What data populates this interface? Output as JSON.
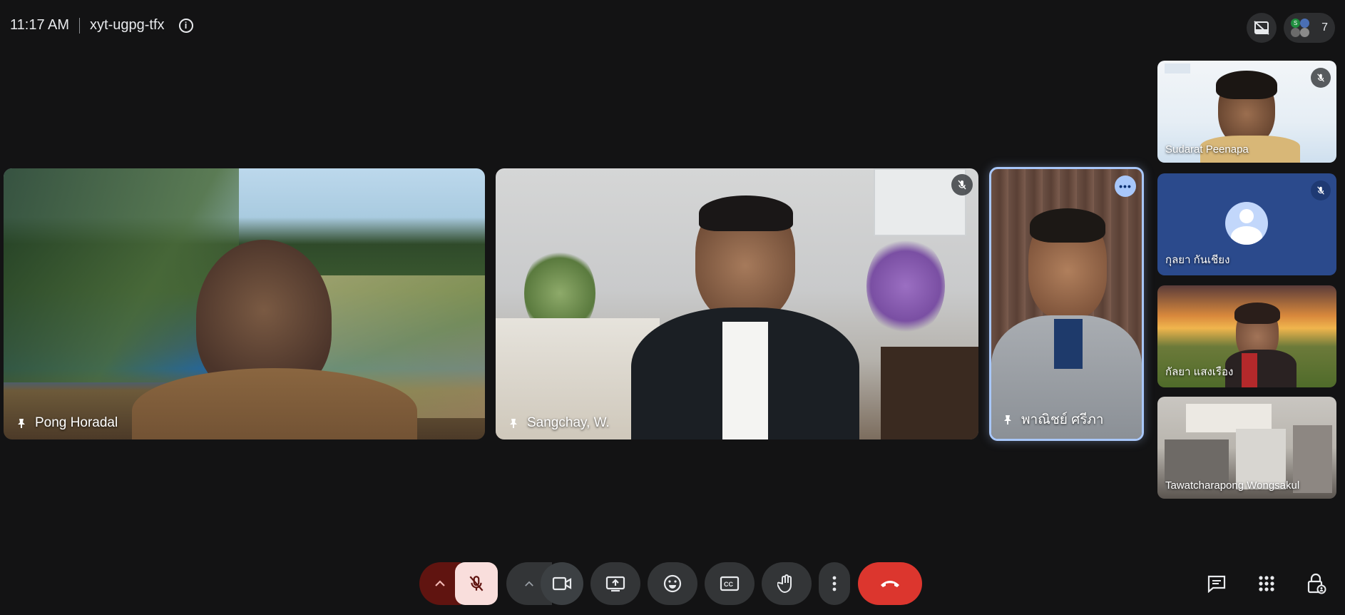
{
  "meeting": {
    "time": "11:17 AM",
    "code": "xyt-ugpg-tfx"
  },
  "participants_count": "7",
  "main_tiles": [
    {
      "name": "Pong Horadal"
    },
    {
      "name": "Sangchay, W."
    },
    {
      "name": "พาณิชย์ ศรีภา"
    }
  ],
  "side_tiles": [
    {
      "name": "Sudarat Peenapa"
    },
    {
      "name": "กุลยา กันเชียง"
    },
    {
      "name": "กัลยา แสงเรือง"
    },
    {
      "name": "Tawatcharapong Wongsakul"
    }
  ],
  "avatar_initial": "S",
  "colors": {
    "end_call": "#dc362e",
    "mic_off_bg": "#f9dedc",
    "mic_caret_bg": "#601410",
    "accent_blue": "#a8c7fa",
    "avatar_tile": "#2b4a8c"
  }
}
